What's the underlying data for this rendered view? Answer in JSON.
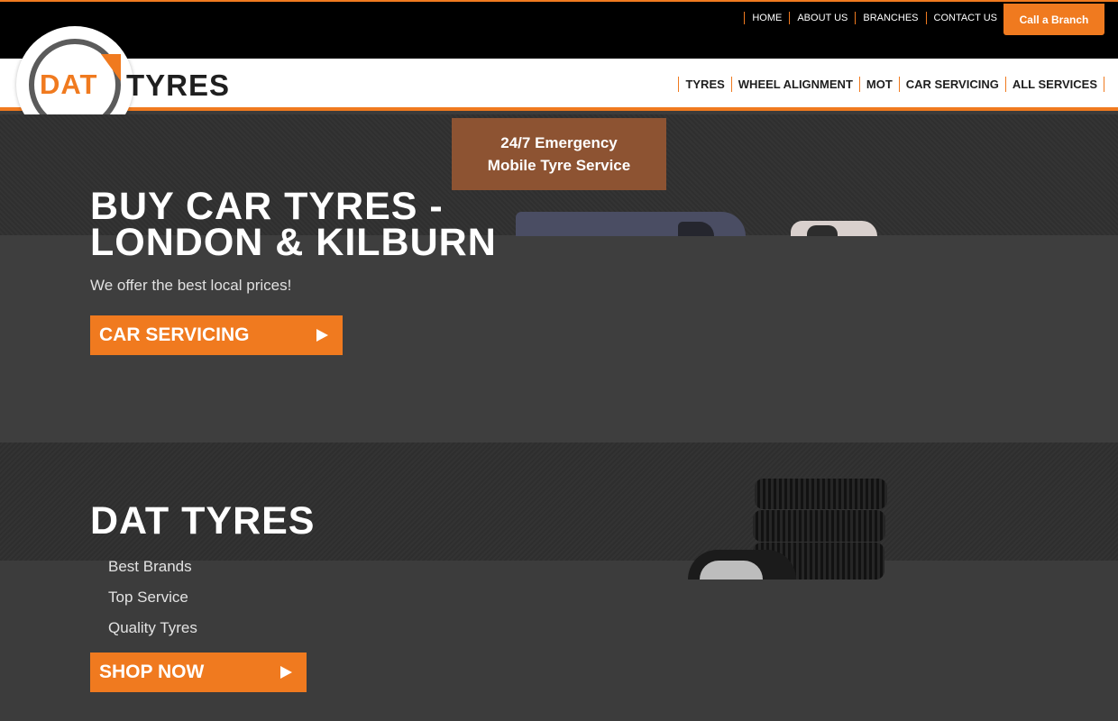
{
  "top_links": [
    "HOME",
    "ABOUT US",
    "BRANCHES",
    "CONTACT US"
  ],
  "call_button": "Call a Branch",
  "logo": {
    "part1": "DAT",
    "part2": "TYRES"
  },
  "main_nav": [
    "TYRES",
    "WHEEL ALIGNMENT",
    "MOT",
    "CAR SERVICING",
    "ALL SERVICES"
  ],
  "emergency": {
    "line1": "24/7 Emergency",
    "line2": "Mobile Tyre Service"
  },
  "hero": {
    "title_line1": "BUY CAR TYRES -",
    "title_line2": "LONDON & KILBURN",
    "subtitle": "We offer the best local prices!",
    "cta": "CAR SERVICING"
  },
  "section2": {
    "title": "DAT TYRES",
    "features": [
      "Best Brands",
      "Top Service",
      "Quality Tyres"
    ],
    "cta": "SHOP NOW"
  },
  "colors": {
    "accent": "#f07a1f",
    "emergency_bg": "#8d5332",
    "dark_bg": "#3c3c3c"
  }
}
